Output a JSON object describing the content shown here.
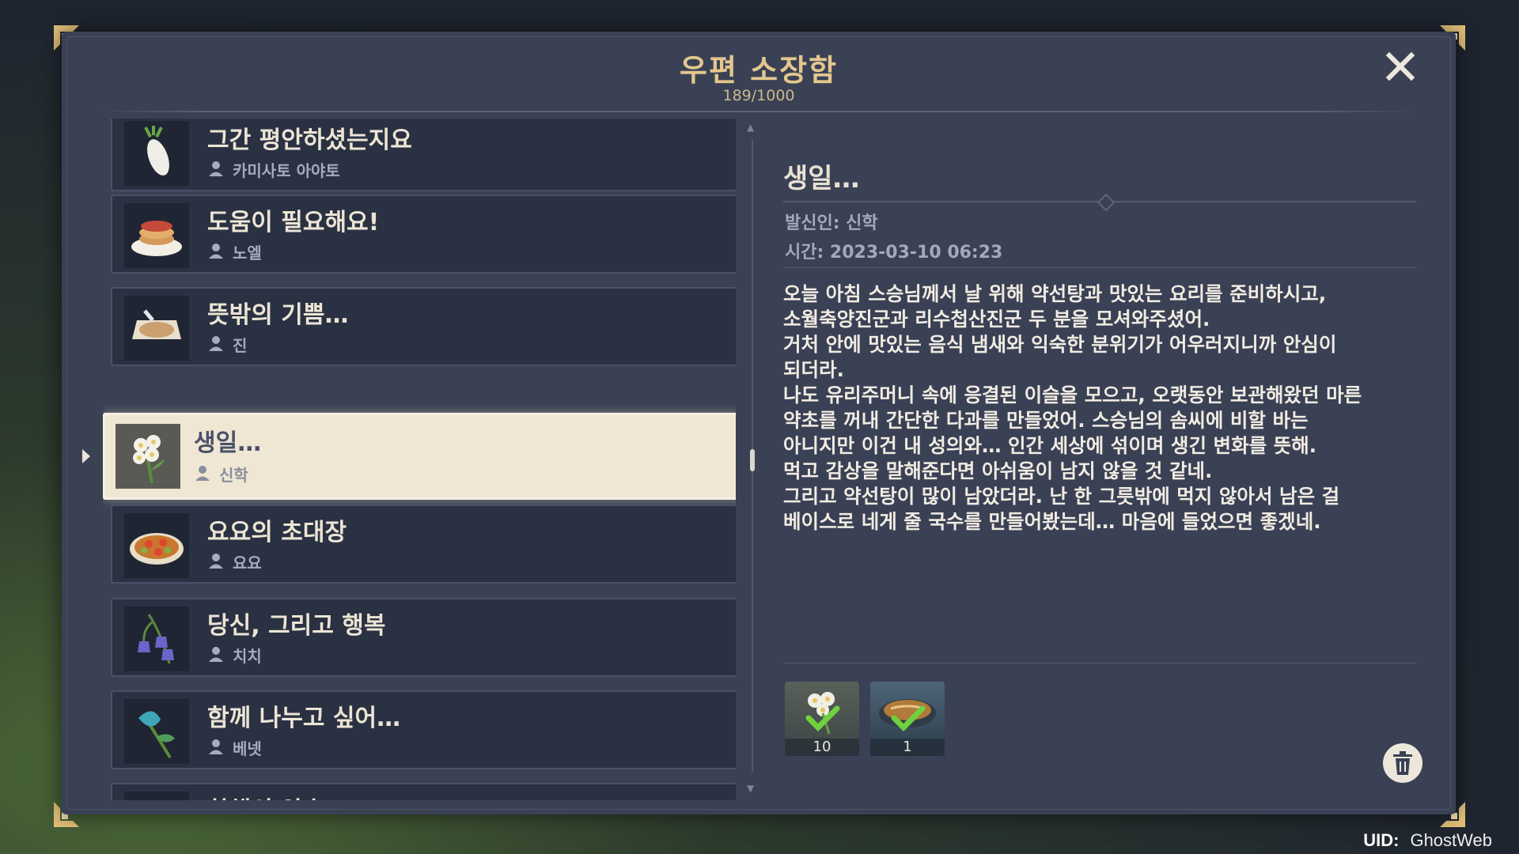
{
  "window": {
    "title": "우편 소장함",
    "count": "189/1000"
  },
  "mail_list": [
    {
      "subject": "그간 평안하셨는지요",
      "sender": "카미사토 아야토",
      "icon": "radish-icon"
    },
    {
      "subject": "도움이 필요해요!",
      "sender": "노엘",
      "icon": "pancake-icon"
    },
    {
      "subject": "뜻밖의 기쁨…",
      "sender": "진",
      "icon": "pie-icon"
    },
    {
      "subject": "생일…",
      "sender": "신학",
      "icon": "white-flower-icon",
      "selected": true
    },
    {
      "subject": "요요의 초대장",
      "sender": "요요",
      "icon": "food-plate-icon"
    },
    {
      "subject": "당신, 그리고 행복",
      "sender": "치치",
      "icon": "bellflower-icon"
    },
    {
      "subject": "함께 나누고 싶어…",
      "sender": "베넷",
      "icon": "blue-flower-icon"
    },
    {
      "subject": "창해의 약속.",
      "sender": "",
      "icon": "crystal-icon"
    }
  ],
  "detail": {
    "subject": "생일…",
    "sender": "발신인: 신학",
    "time": "시간: 2023-03-10 06:23",
    "body": [
      "오늘 아침 스승님께서 날 위해 약선탕과 맛있는 요리를 준비하시고,",
      "소월축양진군과 리수첩산진군 두 분을 모셔와주셨어.",
      "거처 안에 맛있는 음식 냄새와 익숙한 분위기가 어우러지니까 안심이",
      "되더라.",
      "나도 유리주머니 속에 응결된 이슬을 모으고, 오랫동안 보관해왔던 마른",
      "약초를 꺼내 간단한 다과를 만들었어. 스승님의 솜씨에 비할 바는",
      "아니지만 이건 내 성의와… 인간 세상에 섞이며 생긴 변화를 뜻해.",
      "먹고 감상을 말해준다면 아쉬움이 남지 않을 것 같네.",
      "그리고 약선탕이 많이 남았더라. 난 한 그릇밖에 먹지 않아서 남은 걸",
      "베이스로 네게 줄 국수를 만들어봤는데… 마음에 들었으면 좋겠네."
    ],
    "attachments": [
      {
        "item": "white-flower-icon",
        "qty": "10",
        "claimed": true
      },
      {
        "item": "noodle-bowl-icon",
        "qty": "1",
        "claimed": true
      }
    ]
  },
  "footer": {
    "uid_label": "UID:",
    "uid_value": "GhostWeb"
  },
  "colors": {
    "panel": "#3a4155",
    "title_gold": "#e4c78e",
    "selected_bg": "#efe7d4",
    "item_bg": "#2a3142"
  }
}
